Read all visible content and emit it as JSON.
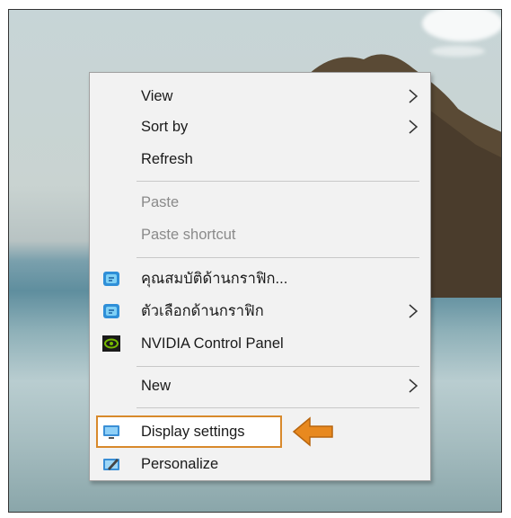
{
  "context_menu": {
    "items": [
      {
        "label": "View",
        "submenu": true
      },
      {
        "label": "Sort by",
        "submenu": true
      },
      {
        "label": "Refresh",
        "submenu": false
      },
      {
        "label": "Paste",
        "disabled": true
      },
      {
        "label": "Paste shortcut",
        "disabled": true
      },
      {
        "label": "คุณสมบัติด้านกราฟิก...",
        "icon": "intel-graphics-icon"
      },
      {
        "label": "ตัวเลือกด้านกราฟิก",
        "icon": "intel-graphics-icon",
        "submenu": true
      },
      {
        "label": "NVIDIA Control Panel",
        "icon": "nvidia-icon"
      },
      {
        "label": "New",
        "submenu": true
      },
      {
        "label": "Display settings",
        "icon": "display-icon",
        "highlighted": true
      },
      {
        "label": "Personalize",
        "icon": "personalize-icon"
      }
    ]
  },
  "annotation": {
    "arrow_color": "#e8891f",
    "highlight_color": "#d8892b"
  }
}
